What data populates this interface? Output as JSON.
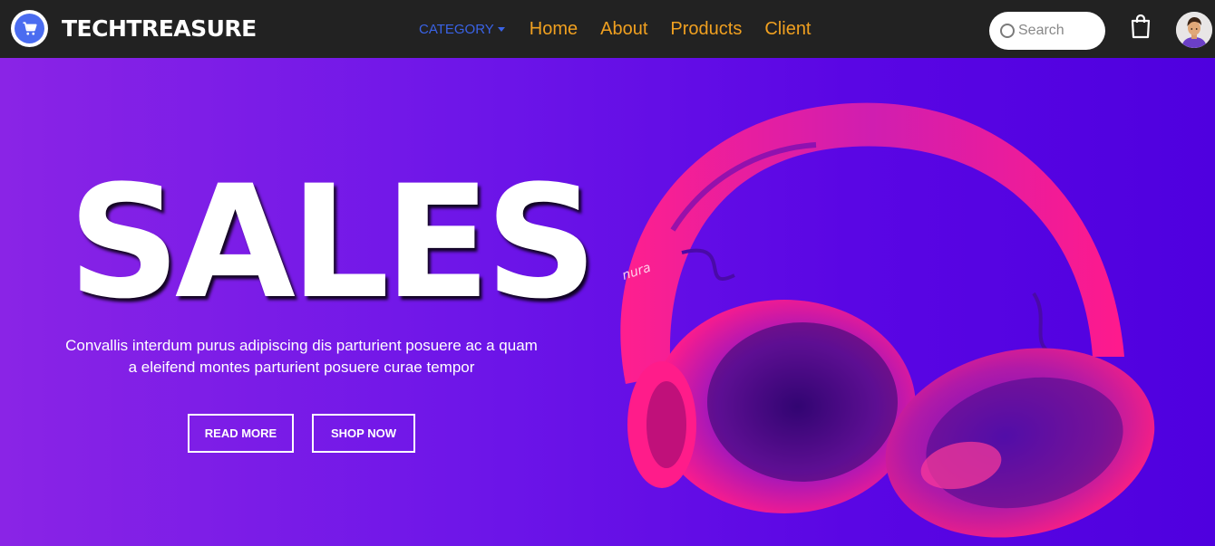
{
  "brand": {
    "name": "TECHTREASURE",
    "logo_icon": "cart-icon"
  },
  "nav": {
    "category_label": "CATEGORY",
    "links": [
      "Home",
      "About",
      "Products",
      "Client"
    ]
  },
  "search": {
    "placeholder": "Search",
    "value": ""
  },
  "hero": {
    "title": "SALES",
    "text": "Convallis interdum purus adipiscing dis parturient posuere ac a quam a eleifend montes parturient posuere curae tempor",
    "read_more_label": "READ MORE",
    "shop_now_label": "SHOP NOW",
    "image": "headphones-image",
    "headphone_brand": "nura"
  },
  "colors": {
    "navbar_bg": "#222222",
    "category_blue": "#3a63e6",
    "nav_link_orange": "#f0a020",
    "hero_gradient_start": "#8a24e6",
    "hero_gradient_end": "#4f00df",
    "headphone_pink": "#ff1a8c"
  }
}
